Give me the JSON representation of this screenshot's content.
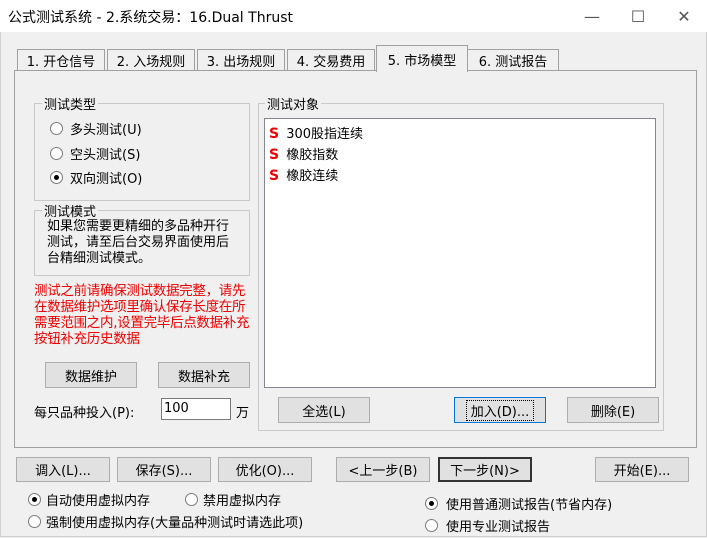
{
  "window": {
    "title": "公式测试系统 - 2.系统交易：16.Dual Thrust",
    "minimize_glyph": "—",
    "maximize_glyph": "☐",
    "close_glyph": "✕"
  },
  "tabs": [
    {
      "label": "1. 开仓信号"
    },
    {
      "label": "2. 入场规则"
    },
    {
      "label": "3. 出场规则"
    },
    {
      "label": "4. 交易费用"
    },
    {
      "label": "5. 市场模型"
    },
    {
      "label": "6. 测试报告"
    }
  ],
  "test_type": {
    "label": "测试类型",
    "options": [
      {
        "label": "多头测试(U)",
        "selected": false
      },
      {
        "label": "空头测试(S)",
        "selected": false
      },
      {
        "label": "双向测试(O)",
        "selected": true
      }
    ]
  },
  "test_mode": {
    "label": "测试模式",
    "text": "如果您需要更精细的多品种开行测试，请至后台交易界面使用后台精细测试模式。"
  },
  "warning_text": "测试之前请确保测试数据完整，请先在数据维护选项里确认保存长度在所需要范围之内,设置完毕后点数据补充按钮补充历史数据",
  "buttons": {
    "data_maintain": "数据维护",
    "data_supplement": "数据补充",
    "select_all": "全选(L)",
    "add": "加入(D)...",
    "delete": "删除(E)",
    "import": "调入(L)...",
    "save": "保存(S)...",
    "optimize": "优化(O)...",
    "prev": "<上一步(B)",
    "next": "下一步(N)>",
    "start": "开始(E)..."
  },
  "investment": {
    "label": "每只品种投入(P):",
    "value": "100",
    "unit": "万"
  },
  "test_objects": {
    "label": "测试对象",
    "icon_letter": "S",
    "items": [
      "300股指连续",
      "橡胶指数",
      "橡胶连续"
    ]
  },
  "virtual_memory": {
    "options": [
      {
        "label": "自动使用虚拟内存",
        "selected": true
      },
      {
        "label": "禁用虚拟内存",
        "selected": false
      },
      {
        "label": "强制使用虚拟内存(大量品种测试时请选此项)",
        "selected": false
      }
    ]
  },
  "report_type": {
    "options": [
      {
        "label": "使用普通测试报告(节省内存)",
        "selected": true
      },
      {
        "label": "使用专业测试报告",
        "selected": false
      }
    ]
  }
}
